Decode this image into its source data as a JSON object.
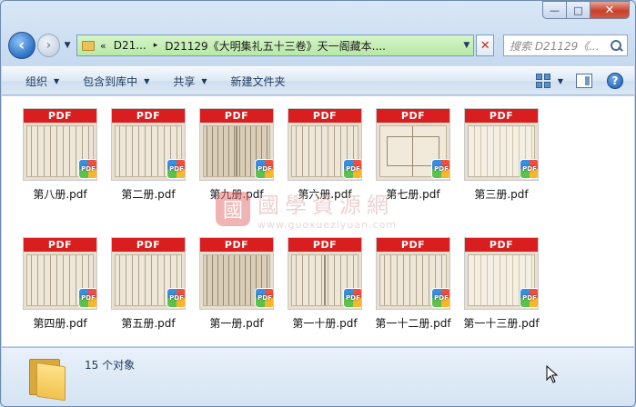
{
  "window": {
    "caption_buttons": {
      "min": "—",
      "max": "□",
      "close": "✕"
    }
  },
  "nav": {
    "back_icon": "back-arrow-icon",
    "forward_icon": "forward-arrow-icon",
    "address": {
      "overflow": "«",
      "crumbs": [
        "D21...",
        "D21129《大明集礼五十三卷》天一阁藏本...."
      ],
      "separator": "▸"
    },
    "clear": "✕",
    "search_placeholder": "搜索 D21129《..."
  },
  "toolbar": {
    "organize": "组织",
    "include_library": "包含到库中",
    "share": "共享",
    "new_folder": "新建文件夹"
  },
  "thumb_band_label": "PDF",
  "badge_label": "PDF",
  "files": [
    {
      "name": "第八册.pdf"
    },
    {
      "name": "第二册.pdf"
    },
    {
      "name": "第九册.pdf"
    },
    {
      "name": "第六册.pdf"
    },
    {
      "name": "第七册.pdf"
    },
    {
      "name": "第三册.pdf"
    },
    {
      "name": "第四册.pdf"
    },
    {
      "name": "第五册.pdf"
    },
    {
      "name": "第一册.pdf"
    },
    {
      "name": "第一十册.pdf"
    },
    {
      "name": "第一十二册.pdf"
    },
    {
      "name": "第一十三册.pdf"
    }
  ],
  "watermark": {
    "seal": "國",
    "title": "國學資源網",
    "url": "www.guoxueziyuan.com"
  },
  "status": {
    "count_text": "15 个对象"
  },
  "colors": {
    "pdf_band": "#d81e1e",
    "address_bg": "#b7e8a6",
    "toolbar_text": "#1e395b"
  }
}
